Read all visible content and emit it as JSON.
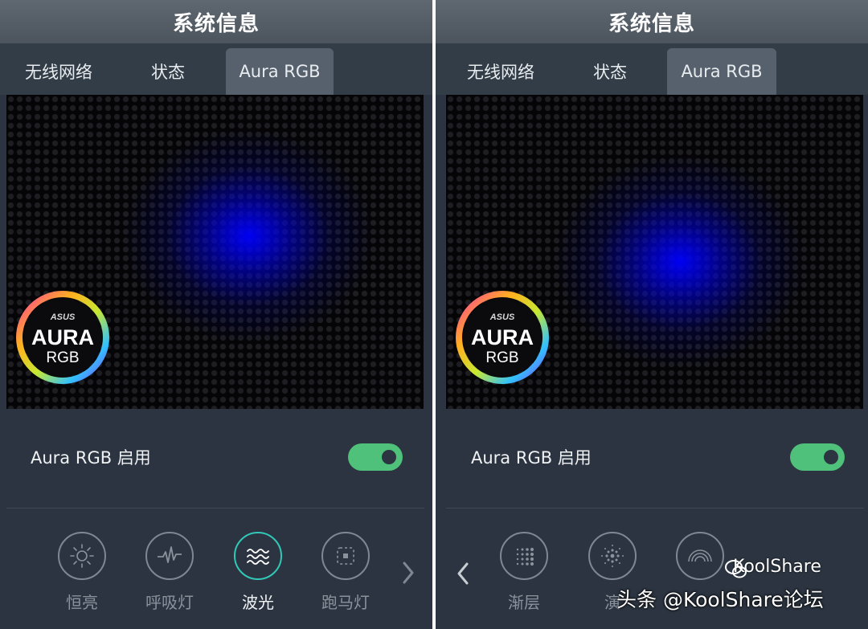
{
  "colors": {
    "panel_bg": "#2b3440",
    "title_bg": "#535b64",
    "tab_active_bg": "#56616d",
    "toggle_on": "#4fc17a",
    "active_mode": "#32c8b8",
    "glow": "#0000ff"
  },
  "screens": [
    {
      "title": "系统信息",
      "tabs": [
        {
          "label": "无线网络",
          "active": false
        },
        {
          "label": "状态",
          "active": false
        },
        {
          "label": "Aura RGB",
          "active": true
        }
      ],
      "logo": {
        "brand": "ASUS",
        "word": "AURA",
        "sub": "RGB"
      },
      "toggle": {
        "label": "Aura RGB 启用",
        "on": true
      },
      "modes": [
        {
          "label": "恒亮",
          "icon": "sun-icon",
          "active": false
        },
        {
          "label": "呼吸灯",
          "icon": "pulse-icon",
          "active": false
        },
        {
          "label": "波光",
          "icon": "wave-icon",
          "active": true
        },
        {
          "label": "跑马灯",
          "icon": "marquee-icon",
          "active": false
        }
      ],
      "nav": "chevron-right-icon"
    },
    {
      "title": "系统信息",
      "tabs": [
        {
          "label": "无线网络",
          "active": false
        },
        {
          "label": "状态",
          "active": false
        },
        {
          "label": "Aura RGB",
          "active": true
        }
      ],
      "logo": {
        "brand": "ASUS",
        "word": "AURA",
        "sub": "RGB"
      },
      "toggle": {
        "label": "Aura RGB 启用",
        "on": true
      },
      "modes": [
        {
          "label": "渐层",
          "icon": "gradient-dots-icon",
          "active": false
        },
        {
          "label": "演",
          "icon": "starburst-icon",
          "active": false
        },
        {
          "label": "",
          "icon": "rainbow-icon",
          "active": false
        }
      ],
      "nav": "chevron-left-icon"
    }
  ],
  "watermark": {
    "main": "头条 @KoolShare论坛",
    "sub": "KoolShare",
    "icon": "wechat-icon"
  }
}
